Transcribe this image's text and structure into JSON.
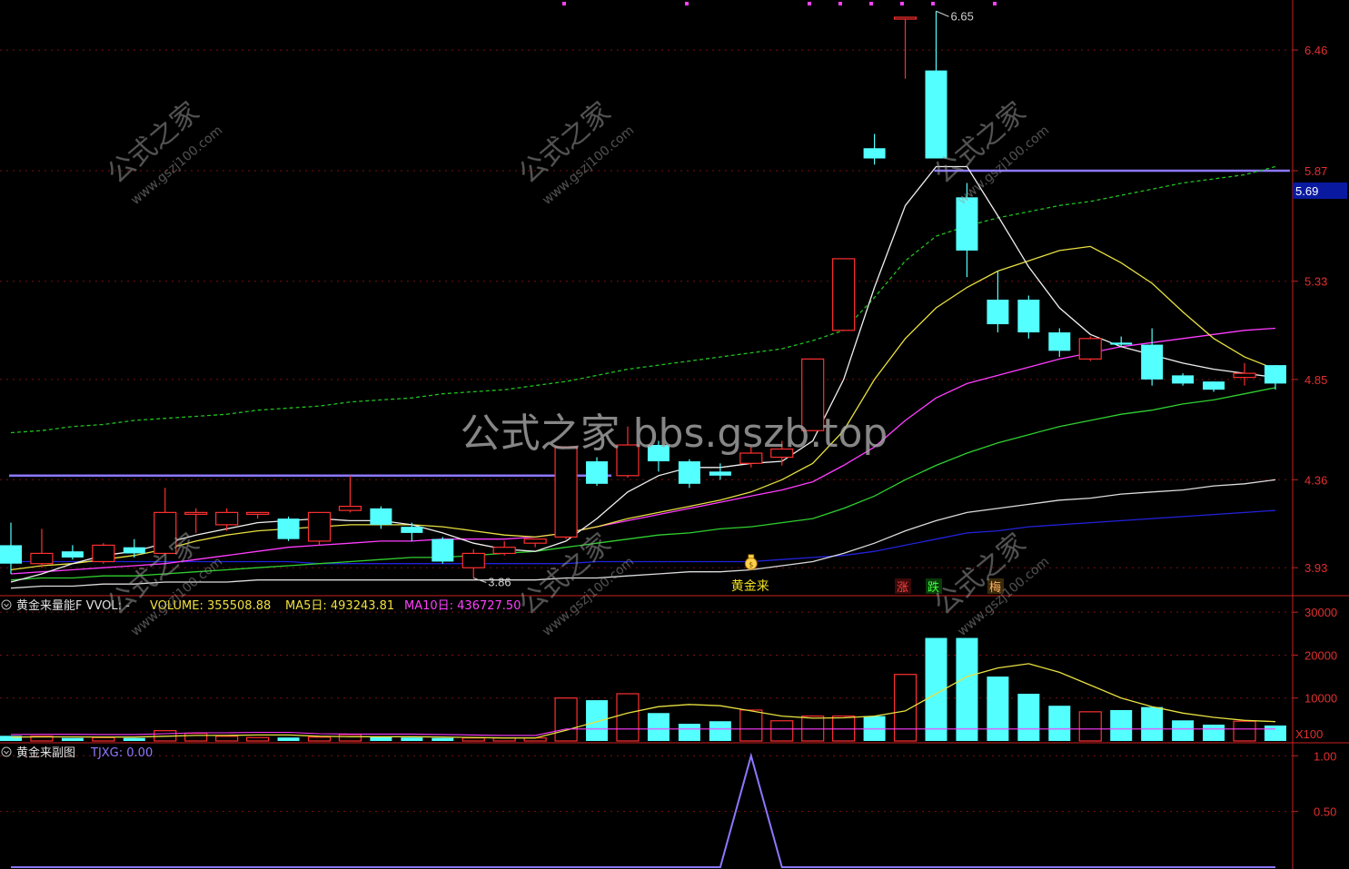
{
  "colors": {
    "background": "#000000",
    "up": "#ff3030",
    "down": "#54ffff",
    "axis": "#cc1f1f",
    "grid": "#7a1010",
    "ma5": "#f0f0f0",
    "ma10": "#e8e040",
    "ma20": "#ff3cff",
    "ma30": "#30d030",
    "ma60": "#dcdcdc",
    "ma120": "#2222dd",
    "ma250": "#20c020",
    "hline": "#8c78ff"
  },
  "watermark": {
    "center": "公式之家 bbs.gszb.top",
    "corner_title": "公式之家",
    "corner_url": "www.gszj100.com"
  },
  "price_panel": {
    "axis_ticks": [
      "6.46",
      "5.87",
      "5.33",
      "4.85",
      "4.36",
      "3.93"
    ],
    "current_price": "5.69",
    "high_label": "6.65",
    "low_label": "3.86",
    "signal_text": "黄金来",
    "signal_icon": "money-bag-icon",
    "tag_up": "涨",
    "tag_down": "跌",
    "tag_third": "梅"
  },
  "volume_panel": {
    "header_name": "黄金来量能F VVOL: -",
    "volume_label": "VOLUME: 355508.88",
    "ma5_label": "MA5日: 493243.81",
    "ma10_label": "MA10日: 436727.50",
    "axis_ticks": [
      "30000",
      "20000",
      "10000"
    ],
    "unit_label": "X100"
  },
  "indicator_panel": {
    "header_name": "黄金来副图",
    "value_label": "TJXG: 0.00",
    "axis_ticks": [
      "1.00",
      "0.50"
    ]
  },
  "chart_data": {
    "type": "candlestick",
    "price_ylim": [
      3.82,
      6.66
    ],
    "volume_ylim": [
      0,
      33000
    ],
    "indicator_ylim": [
      0,
      1.1
    ],
    "candles": [
      {
        "o": 4.04,
        "h": 4.15,
        "l": 3.9,
        "c": 3.95
      },
      {
        "o": 3.95,
        "h": 4.12,
        "l": 3.93,
        "c": 4.0
      },
      {
        "o": 4.01,
        "h": 4.04,
        "l": 3.97,
        "c": 3.98
      },
      {
        "o": 3.96,
        "h": 4.05,
        "l": 3.95,
        "c": 4.04
      },
      {
        "o": 4.03,
        "h": 4.07,
        "l": 3.98,
        "c": 4.0
      },
      {
        "o": 4.0,
        "h": 4.32,
        "l": 3.99,
        "c": 4.2
      },
      {
        "o": 4.2,
        "h": 4.22,
        "l": 4.1,
        "c": 4.2
      },
      {
        "o": 4.14,
        "h": 4.22,
        "l": 4.11,
        "c": 4.2
      },
      {
        "o": 4.2,
        "h": 4.2,
        "l": 4.17,
        "c": 4.2
      },
      {
        "o": 4.17,
        "h": 4.18,
        "l": 4.06,
        "c": 4.07
      },
      {
        "o": 4.06,
        "h": 4.2,
        "l": 4.04,
        "c": 4.2
      },
      {
        "o": 4.21,
        "h": 4.38,
        "l": 4.2,
        "c": 4.23
      },
      {
        "o": 4.22,
        "h": 4.23,
        "l": 4.12,
        "c": 4.14
      },
      {
        "o": 4.13,
        "h": 4.15,
        "l": 4.06,
        "c": 4.1
      },
      {
        "o": 4.07,
        "h": 4.08,
        "l": 3.95,
        "c": 3.96
      },
      {
        "o": 3.93,
        "h": 4.02,
        "l": 3.88,
        "c": 4.0
      },
      {
        "o": 4.0,
        "h": 4.06,
        "l": 3.99,
        "c": 4.03
      },
      {
        "o": 4.05,
        "h": 4.06,
        "l": 4.03,
        "c": 4.07
      },
      {
        "o": 4.08,
        "h": 4.52,
        "l": 4.07,
        "c": 4.52
      },
      {
        "o": 4.45,
        "h": 4.47,
        "l": 4.33,
        "c": 4.34
      },
      {
        "o": 4.38,
        "h": 4.62,
        "l": 4.37,
        "c": 4.53
      },
      {
        "o": 4.53,
        "h": 4.55,
        "l": 4.4,
        "c": 4.45
      },
      {
        "o": 4.45,
        "h": 4.46,
        "l": 4.32,
        "c": 4.34
      },
      {
        "o": 4.4,
        "h": 4.44,
        "l": 4.36,
        "c": 4.38
      },
      {
        "o": 4.44,
        "h": 4.52,
        "l": 4.42,
        "c": 4.49
      },
      {
        "o": 4.47,
        "h": 4.55,
        "l": 4.43,
        "c": 4.51
      },
      {
        "o": 4.6,
        "h": 4.95,
        "l": 4.6,
        "c": 4.95
      },
      {
        "o": 5.09,
        "h": 5.44,
        "l": 5.09,
        "c": 5.44
      },
      {
        "o": 5.98,
        "h": 6.05,
        "l": 5.9,
        "c": 5.93
      },
      {
        "o": 6.62,
        "h": 6.62,
        "l": 6.32,
        "c": 6.62
      },
      {
        "o": 6.36,
        "h": 6.65,
        "l": 5.93,
        "c": 5.93
      },
      {
        "o": 5.74,
        "h": 5.81,
        "l": 5.35,
        "c": 5.48
      },
      {
        "o": 5.24,
        "h": 5.38,
        "l": 5.08,
        "c": 5.12
      },
      {
        "o": 5.24,
        "h": 5.26,
        "l": 5.05,
        "c": 5.08
      },
      {
        "o": 5.08,
        "h": 5.1,
        "l": 4.96,
        "c": 4.99
      },
      {
        "o": 4.95,
        "h": 5.06,
        "l": 4.94,
        "c": 5.05
      },
      {
        "o": 5.03,
        "h": 5.06,
        "l": 5.01,
        "c": 5.02
      },
      {
        "o": 5.02,
        "h": 5.1,
        "l": 4.82,
        "c": 4.85
      },
      {
        "o": 4.87,
        "h": 4.88,
        "l": 4.82,
        "c": 4.83
      },
      {
        "o": 4.84,
        "h": 4.84,
        "l": 4.79,
        "c": 4.8
      },
      {
        "o": 4.86,
        "h": 4.93,
        "l": 4.82,
        "c": 4.88
      },
      {
        "o": 4.92,
        "h": 4.92,
        "l": 4.8,
        "c": 4.83
      }
    ],
    "volumes": [
      1200,
      1100,
      700,
      800,
      700,
      2400,
      1800,
      1100,
      800,
      800,
      900,
      1500,
      1000,
      800,
      700,
      700,
      700,
      700,
      10000,
      9500,
      11000,
      6500,
      4000,
      4600,
      7200,
      4700,
      5800,
      5800,
      5800,
      15500,
      24000,
      24000,
      15000,
      11000,
      8200,
      6800,
      7200,
      7900,
      4800,
      3800,
      4600,
      3600
    ],
    "vol_ma": [
      900,
      950,
      950,
      900,
      900,
      1100,
      1300,
      1300,
      1400,
      1400,
      1100,
      1000,
      1000,
      1000,
      900,
      800,
      700,
      700,
      2500,
      4500,
      6500,
      8000,
      8500,
      8200,
      7000,
      5800,
      5300,
      5400,
      5800,
      7000,
      11000,
      15000,
      17000,
      18000,
      16000,
      13000,
      10000,
      8000,
      6500,
      5500,
      4800,
      4500
    ],
    "ma5": [
      3.86,
      3.9,
      3.95,
      3.99,
      4.01,
      4.05,
      4.09,
      4.12,
      4.15,
      4.16,
      4.17,
      4.16,
      4.16,
      4.14,
      4.1,
      4.05,
      4.02,
      4.01,
      4.06,
      4.17,
      4.3,
      4.38,
      4.42,
      4.42,
      4.44,
      4.45,
      4.55,
      4.85,
      5.3,
      5.7,
      5.89,
      5.89,
      5.65,
      5.4,
      5.2,
      5.07,
      5.01,
      4.97,
      4.93,
      4.9,
      4.88,
      4.86
    ],
    "ma10": [
      3.92,
      3.94,
      3.95,
      3.97,
      3.99,
      4.02,
      4.06,
      4.09,
      4.11,
      4.12,
      4.13,
      4.14,
      4.14,
      4.14,
      4.13,
      4.11,
      4.09,
      4.08,
      4.1,
      4.13,
      4.17,
      4.2,
      4.23,
      4.26,
      4.3,
      4.36,
      4.44,
      4.6,
      4.85,
      5.05,
      5.2,
      5.3,
      5.38,
      5.43,
      5.48,
      5.5,
      5.42,
      5.32,
      5.18,
      5.05,
      4.96,
      4.9
    ],
    "ma20": [
      3.9,
      3.91,
      3.92,
      3.93,
      3.94,
      3.95,
      3.97,
      3.99,
      4.01,
      4.03,
      4.04,
      4.05,
      4.06,
      4.06,
      4.07,
      4.07,
      4.07,
      4.08,
      4.1,
      4.13,
      4.16,
      4.19,
      4.22,
      4.25,
      4.28,
      4.31,
      4.35,
      4.43,
      4.52,
      4.65,
      4.76,
      4.83,
      4.87,
      4.91,
      4.95,
      4.98,
      5.01,
      5.03,
      5.05,
      5.07,
      5.09,
      5.1
    ],
    "ma30": [
      3.87,
      3.88,
      3.88,
      3.89,
      3.89,
      3.9,
      3.91,
      3.92,
      3.93,
      3.94,
      3.95,
      3.96,
      3.97,
      3.98,
      3.98,
      3.99,
      4.0,
      4.01,
      4.03,
      4.05,
      4.07,
      4.09,
      4.1,
      4.12,
      4.13,
      4.15,
      4.17,
      4.22,
      4.28,
      4.36,
      4.43,
      4.49,
      4.54,
      4.58,
      4.62,
      4.65,
      4.68,
      4.7,
      4.73,
      4.75,
      4.78,
      4.81
    ],
    "ma60": [
      3.83,
      3.84,
      3.84,
      3.85,
      3.85,
      3.86,
      3.86,
      3.86,
      3.87,
      3.87,
      3.87,
      3.87,
      3.87,
      3.87,
      3.87,
      3.87,
      3.87,
      3.87,
      3.88,
      3.88,
      3.89,
      3.9,
      3.91,
      3.91,
      3.92,
      3.94,
      3.96,
      4.0,
      4.05,
      4.11,
      4.16,
      4.2,
      4.22,
      4.24,
      4.26,
      4.27,
      4.29,
      4.3,
      4.31,
      4.33,
      4.34,
      4.36
    ],
    "ma120": [
      3.96,
      3.96,
      3.96,
      3.96,
      3.96,
      3.96,
      3.96,
      3.96,
      3.96,
      3.96,
      3.95,
      3.95,
      3.95,
      3.95,
      3.95,
      3.95,
      3.95,
      3.95,
      3.95,
      3.96,
      3.96,
      3.96,
      3.96,
      3.96,
      3.96,
      3.97,
      3.98,
      3.99,
      4.01,
      4.04,
      4.07,
      4.1,
      4.11,
      4.13,
      4.14,
      4.15,
      4.16,
      4.17,
      4.18,
      4.19,
      4.2,
      4.21
    ],
    "ma250": [
      4.59,
      4.6,
      4.62,
      4.63,
      4.65,
      4.66,
      4.67,
      4.68,
      4.7,
      4.71,
      4.72,
      4.74,
      4.75,
      4.76,
      4.78,
      4.79,
      4.8,
      4.82,
      4.84,
      4.87,
      4.9,
      4.92,
      4.94,
      4.96,
      4.98,
      5.0,
      5.04,
      5.09,
      5.25,
      5.43,
      5.55,
      5.6,
      5.64,
      5.67,
      5.7,
      5.72,
      5.75,
      5.78,
      5.81,
      5.83,
      5.85,
      5.89
    ],
    "tjxg": [
      0,
      0,
      0,
      0,
      0,
      0,
      0,
      0,
      0,
      0,
      0,
      0,
      0,
      0,
      0,
      0,
      0,
      0,
      0,
      0,
      0,
      0,
      0,
      0,
      1,
      0,
      0,
      0,
      0,
      0,
      0,
      0,
      0,
      0,
      0,
      0,
      0,
      0,
      0,
      0,
      0,
      0
    ],
    "horizontal_levels": [
      {
        "value": 4.38,
        "from": 0,
        "to": 19
      },
      {
        "value": 5.87,
        "from": 30,
        "to": 41
      }
    ],
    "signal_index": 24,
    "high_index": 30,
    "low_index": 15
  }
}
